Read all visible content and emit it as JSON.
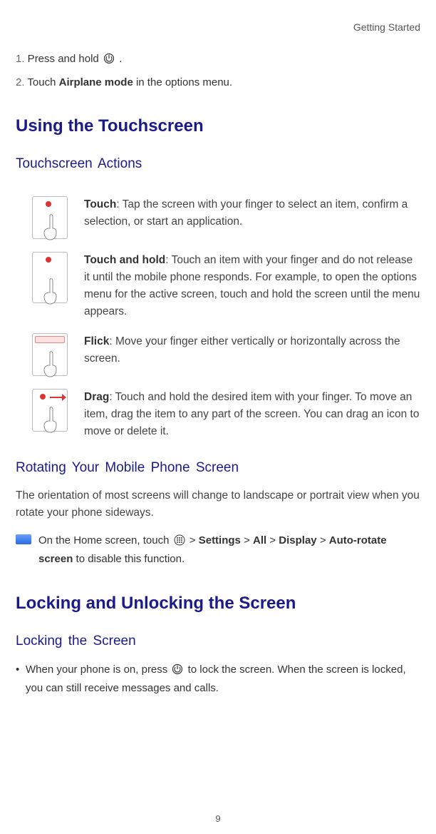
{
  "header": {
    "section": "Getting Started"
  },
  "steps": {
    "s1_num": "1.",
    "s1_a": " Press and hold ",
    "s1_b": " .",
    "s2_num": "2.",
    "s2_a": " Touch ",
    "s2_bold": "Airplane mode",
    "s2_b": " in the options menu."
  },
  "headings": {
    "h1a": "Using the Touchscreen",
    "h2a": "Touchscreen Actions",
    "h2b": "Rotating Your Mobile Phone Screen",
    "h1b": "Locking and Unlocking the Screen",
    "h2c": "Locking the Screen"
  },
  "actions": {
    "touch_term": "Touch",
    "touch_body": ": Tap the screen with your finger to select an item, confirm a selection, or start an application.",
    "hold_term": "Touch and hold",
    "hold_body": ": Touch an item with your finger and do not release it until the mobile phone responds. For example, to open the options menu for the active screen, touch and hold the screen until the menu appears.",
    "flick_term": "Flick",
    "flick_body": ": Move your finger either vertically or horizontally across the screen.",
    "drag_term": "Drag",
    "drag_body": ": Touch and hold the desired item with your finger. To move an item, drag the item to any part of the screen. You can drag an icon to move or delete it."
  },
  "rotate_para": "The orientation of most screens will change to landscape or portrait view when you rotate your phone sideways.",
  "tip": {
    "a": "On the Home screen, touch ",
    "b": " > ",
    "c1": "Settings",
    "c2": "All",
    "c3": "Display",
    "c4": "Auto-rotate screen",
    "d": " to disable this function."
  },
  "lock_bullet": {
    "a": "When your phone is on, press ",
    "b": " to lock the screen. When the screen is locked, you can still receive messages and calls."
  },
  "page_number": "9"
}
